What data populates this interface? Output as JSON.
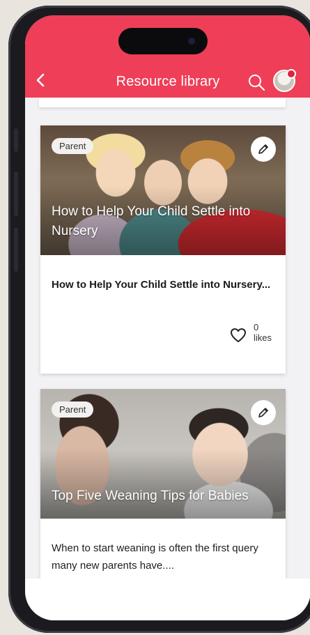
{
  "header": {
    "title": "Resource library",
    "back_icon": "chevron-left-icon",
    "search_icon": "search-icon",
    "avatar_has_notification": true
  },
  "colors": {
    "brand": "#ef3e57"
  },
  "cards": [
    {
      "badge": "Parent",
      "image_title": "How to Help Your Child Settle into Nursery",
      "summary": "How to Help Your Child Settle into Nursery...",
      "likes_count": "0",
      "likes_label": "likes"
    },
    {
      "badge": "Parent",
      "image_title": "Top Five Weaning Tips for Babies",
      "summary": "When to start weaning is often the first query many new parents have...."
    }
  ]
}
